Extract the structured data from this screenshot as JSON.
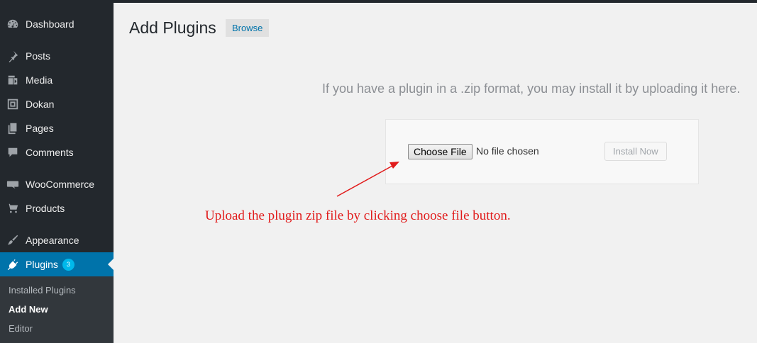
{
  "sidebar": {
    "items": [
      {
        "label": "Dashboard",
        "icon": "dashboard-icon"
      },
      {
        "label": "Posts",
        "icon": "pin-icon"
      },
      {
        "label": "Media",
        "icon": "media-icon"
      },
      {
        "label": "Dokan",
        "icon": "dokan-icon"
      },
      {
        "label": "Pages",
        "icon": "pages-icon"
      },
      {
        "label": "Comments",
        "icon": "comment-icon"
      },
      {
        "label": "WooCommerce",
        "icon": "woocommerce-icon"
      },
      {
        "label": "Products",
        "icon": "cart-icon"
      },
      {
        "label": "Appearance",
        "icon": "brush-icon"
      },
      {
        "label": "Plugins",
        "icon": "plug-icon",
        "badge": "3",
        "active": true
      }
    ],
    "submenu": [
      {
        "label": "Installed Plugins"
      },
      {
        "label": "Add New",
        "current": true
      },
      {
        "label": "Editor"
      }
    ]
  },
  "header": {
    "title": "Add Plugins",
    "browse_label": "Browse"
  },
  "upload": {
    "help_text": "If you have a plugin in a .zip format, you may install it by uploading it here.",
    "choose_label": "Choose File",
    "no_file_label": "No file chosen",
    "install_label": "Install Now"
  },
  "annotation": {
    "text": "Upload the plugin zip file by clicking choose file button."
  },
  "colors": {
    "sidebar_bg": "#23282d",
    "active_bg": "#0073aa",
    "badge": "#00b9eb",
    "annotation": "#e11b1b"
  }
}
